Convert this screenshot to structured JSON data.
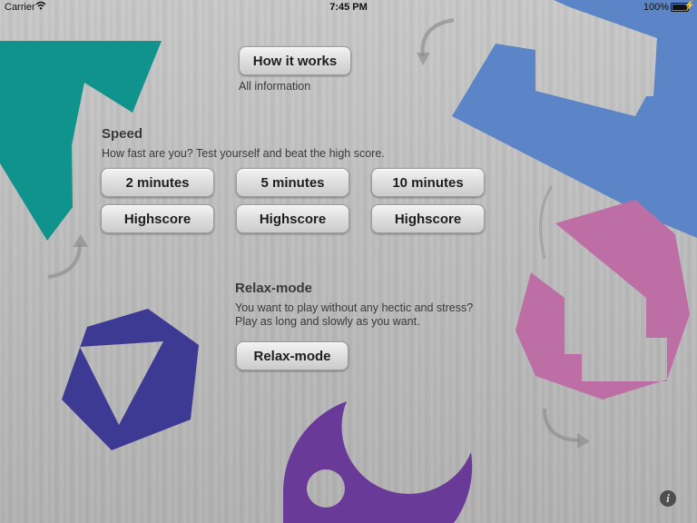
{
  "status_bar": {
    "carrier": "Carrier",
    "time": "7:45 PM",
    "battery_percent": "100%",
    "battery_level": 1.0
  },
  "how_it_works": {
    "button_label": "How it works",
    "caption": "All information"
  },
  "speed": {
    "heading": "Speed",
    "description": "How fast are you? Test yourself and beat the high score.",
    "modes": [
      {
        "time_label": "2 minutes",
        "highscore_label": "Highscore"
      },
      {
        "time_label": "5 minutes",
        "highscore_label": "Highscore"
      },
      {
        "time_label": "10 minutes",
        "highscore_label": "Highscore"
      }
    ]
  },
  "relax": {
    "heading": "Relax-mode",
    "description_line1": "You want to play without any hectic and stress?",
    "description_line2": "Play as long and slowly as you want.",
    "button_label": "Relax-mode"
  },
  "info_icon_glyph": "i",
  "colors": {
    "teal": "#0f938c",
    "blue": "#5b85c6",
    "pink": "#bd6fa5",
    "indigo": "#3d3a93",
    "purple": "#6a3a98"
  }
}
